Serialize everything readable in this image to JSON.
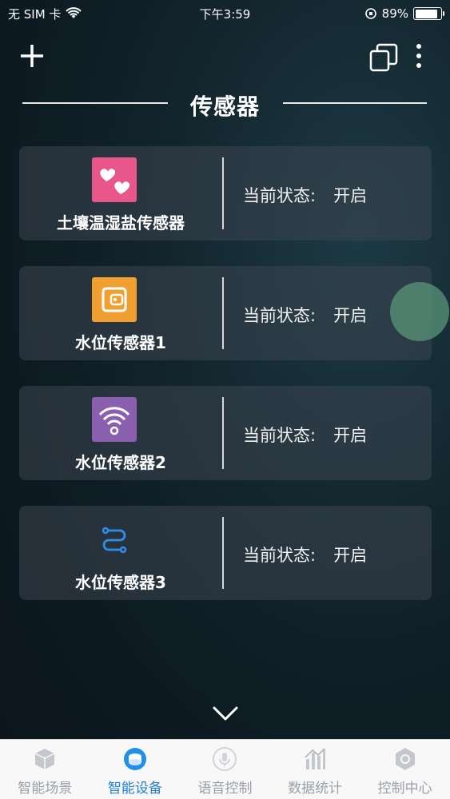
{
  "status_bar": {
    "carrier": "无 SIM 卡",
    "time": "下午3:59",
    "battery_percent": "89%",
    "battery_level": 0.89
  },
  "top_nav": {
    "add_icon": "plus-icon",
    "copy_icon": "copy-icon",
    "more_icon": "more-vertical-icon"
  },
  "section": {
    "title": "传感器"
  },
  "devices": [
    {
      "name": "土壤温湿盐传感器",
      "status_label": "当前状态:",
      "status_value": "开启",
      "icon": "hearts-icon",
      "icon_bg": "#e8578a"
    },
    {
      "name": "水位传感器1",
      "status_label": "当前状态:",
      "status_value": "开启",
      "icon": "wallet-icon",
      "icon_bg": "#f0a030"
    },
    {
      "name": "水位传感器2",
      "status_label": "当前状态:",
      "status_value": "开启",
      "icon": "wifi-icon",
      "icon_bg": "#8a5fb0"
    },
    {
      "name": "水位传感器3",
      "status_label": "当前状态:",
      "status_value": "开启",
      "icon": "route-icon",
      "icon_bg": "none"
    }
  ],
  "footer": {
    "expand_icon": "chevron-down-icon"
  },
  "tabs": [
    {
      "label": "智能场景",
      "icon": "cube-icon",
      "active": false
    },
    {
      "label": "智能设备",
      "icon": "device-icon",
      "active": true
    },
    {
      "label": "语音控制",
      "icon": "microphone-icon",
      "active": false
    },
    {
      "label": "数据统计",
      "icon": "chart-icon",
      "active": false
    },
    {
      "label": "控制中心",
      "icon": "hexagon-icon",
      "active": false
    }
  ],
  "colors": {
    "accent": "#1f7fd8",
    "tab_inactive": "#9aa0a6",
    "card_bg": "#3c4650"
  }
}
